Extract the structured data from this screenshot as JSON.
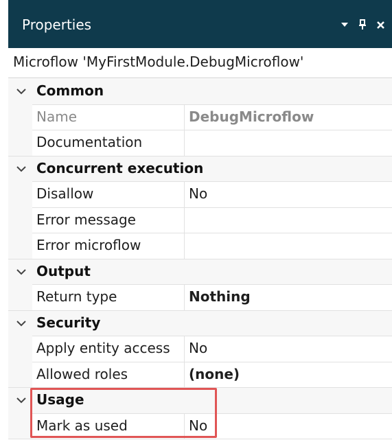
{
  "panel": {
    "title": "Properties",
    "colors": {
      "titlebar": "#0f3a4c",
      "highlight": "#e05555"
    }
  },
  "header": {
    "text": "Microflow 'MyFirstModule.DebugMicroflow'"
  },
  "sections": {
    "common": {
      "label": "Common",
      "name": {
        "label": "Name",
        "value": "DebugMicroflow"
      },
      "documentation": {
        "label": "Documentation",
        "value": ""
      }
    },
    "concurrent": {
      "label": "Concurrent execution",
      "disallow": {
        "label": "Disallow",
        "value": "No"
      },
      "error_message": {
        "label": "Error message",
        "value": ""
      },
      "error_microflow": {
        "label": "Error microflow",
        "value": ""
      }
    },
    "output": {
      "label": "Output",
      "return_type": {
        "label": "Return type",
        "value": "Nothing"
      }
    },
    "security": {
      "label": "Security",
      "apply_entity_access": {
        "label": "Apply entity access",
        "value": "No"
      },
      "allowed_roles": {
        "label": "Allowed roles",
        "value": "(none)"
      }
    },
    "usage": {
      "label": "Usage",
      "mark_as_used": {
        "label": "Mark as used",
        "value": "No"
      }
    }
  }
}
